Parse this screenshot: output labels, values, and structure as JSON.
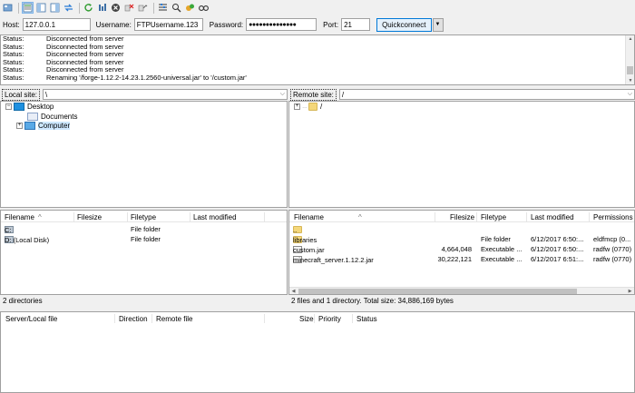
{
  "toolbar": {
    "buttons": [
      "site-manager-icon",
      "toggle-log-icon",
      "toggle-local-tree-icon",
      "toggle-remote-tree-icon",
      "toggle-queue-icon",
      "refresh-icon",
      "process-queue-icon",
      "cancel-icon",
      "disconnect-icon",
      "reconnect-icon",
      "filter-icon",
      "compare-icon",
      "sync-browse-icon",
      "search-icon"
    ]
  },
  "quickconnect": {
    "host_label": "Host:",
    "host_value": "127.0.0.1",
    "username_label": "Username:",
    "username_value": "FTPUsername.123",
    "password_label": "Password:",
    "password_value": "●●●●●●●●●●●●●●",
    "port_label": "Port:",
    "port_value": "21",
    "button_label": "Quickconnect"
  },
  "log": [
    {
      "key": "Status:",
      "msg": "Disconnected from server"
    },
    {
      "key": "Status:",
      "msg": "Disconnected from server"
    },
    {
      "key": "Status:",
      "msg": "Disconnected from server"
    },
    {
      "key": "Status:",
      "msg": "Disconnected from server"
    },
    {
      "key": "Status:",
      "msg": "Disconnected from server"
    },
    {
      "key": "Status:",
      "msg": "Renaming '/forge-1.12.2-14.23.1.2560-universal.jar' to '/custom.jar'"
    }
  ],
  "local": {
    "site_label": "Local site:",
    "site_path": "\\",
    "tree": {
      "desktop": "Desktop",
      "documents": "Documents",
      "computer": "Computer"
    },
    "columns": {
      "filename": "Filename",
      "filesize": "Filesize",
      "filetype": "Filetype",
      "last_modified": "Last modified"
    },
    "rows": [
      {
        "name": "C:",
        "type": "File folder"
      },
      {
        "name": "D: (Local Disk)",
        "type": "File folder"
      }
    ],
    "status": "2 directories"
  },
  "remote": {
    "site_label": "Remote site:",
    "site_path": "/",
    "tree_root": "/",
    "columns": {
      "filename": "Filename",
      "filesize": "Filesize",
      "filetype": "Filetype",
      "last_modified": "Last modified",
      "permissions": "Permissions"
    },
    "parent_row": "..",
    "rows": [
      {
        "name": "libraries",
        "size": "",
        "type": "File folder",
        "modified": "6/12/2017 6:50:...",
        "perms": "eldfmcp (0..."
      },
      {
        "name": "custom.jar",
        "size": "4,664,048",
        "type": "Executable ...",
        "modified": "6/12/2017 6:50:...",
        "perms": "radfw (0770)"
      },
      {
        "name": "minecraft_server.1.12.2.jar",
        "size": "30,222,121",
        "type": "Executable ...",
        "modified": "6/12/2017 6:51:...",
        "perms": "radfw (0770)"
      }
    ],
    "status": "2 files and 1 directory. Total size: 34,886,169 bytes"
  },
  "queue": {
    "columns": {
      "server_local": "Server/Local file",
      "direction": "Direction",
      "remote": "Remote file",
      "size": "Size",
      "priority": "Priority",
      "status": "Status"
    }
  }
}
